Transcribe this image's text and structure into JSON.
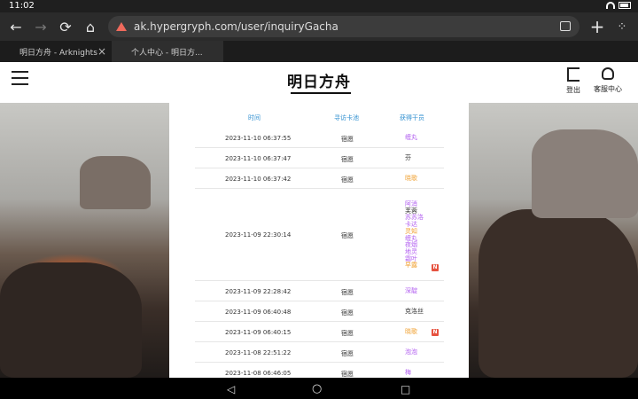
{
  "status": {
    "time": "11:02"
  },
  "browser": {
    "url": "ak.hypergryph.com/user/inquiryGacha",
    "tabs": [
      {
        "label": "明日方舟 - Arknights"
      },
      {
        "label": "个人中心 - 明日方..."
      }
    ]
  },
  "header": {
    "logo": "明日方舟",
    "logout_label": "登出",
    "support_label": "客服中心"
  },
  "table": {
    "headers": [
      "时间",
      "寻访卡池",
      "获得干员"
    ],
    "rows": [
      {
        "time": "2023-11-10 06:37:55",
        "pool": "宿愿",
        "ops": [
          {
            "name": "缠丸",
            "color": "#b25ff0"
          }
        ]
      },
      {
        "time": "2023-11-10 06:37:47",
        "pool": "宿愿",
        "ops": [
          {
            "name": "芬",
            "color": "#333333"
          }
        ]
      },
      {
        "time": "2023-11-10 06:37:42",
        "pool": "宿愿",
        "ops": [
          {
            "name": "晓歌",
            "color": "#f0a030"
          }
        ]
      },
      {
        "time": "2023-11-09 22:30:14",
        "pool": "宿愿",
        "new": "N",
        "ops": [
          {
            "name": "阿消",
            "color": "#b25ff0"
          },
          {
            "name": "芙蓉",
            "color": "#333333"
          },
          {
            "name": "苏苏洛",
            "color": "#b25ff0"
          },
          {
            "name": "卡达",
            "color": "#b25ff0"
          },
          {
            "name": "灵知",
            "color": "#f0a030"
          },
          {
            "name": "缠丸",
            "color": "#b25ff0"
          },
          {
            "name": "夜烟",
            "color": "#b25ff0"
          },
          {
            "name": "地灵",
            "color": "#b25ff0"
          },
          {
            "name": "霜叶",
            "color": "#b25ff0"
          },
          {
            "name": "早露",
            "color": "#f0a030"
          }
        ]
      },
      {
        "time": "2023-11-09 22:28:42",
        "pool": "宿愿",
        "ops": [
          {
            "name": "深靛",
            "color": "#b25ff0"
          }
        ]
      },
      {
        "time": "2023-11-09 06:40:48",
        "pool": "宿愿",
        "ops": [
          {
            "name": "克洛丝",
            "color": "#333333"
          }
        ]
      },
      {
        "time": "2023-11-09 06:40:15",
        "pool": "宿愿",
        "new": "N",
        "ops": [
          {
            "name": "晓歌",
            "color": "#f0a030"
          }
        ]
      },
      {
        "time": "2023-11-08 22:51:22",
        "pool": "宿愿",
        "ops": [
          {
            "name": "泡泡",
            "color": "#b25ff0"
          }
        ]
      },
      {
        "time": "2023-11-08 06:46:05",
        "pool": "宿愿",
        "ops": [
          {
            "name": "梅",
            "color": "#b25ff0"
          }
        ]
      }
    ]
  }
}
